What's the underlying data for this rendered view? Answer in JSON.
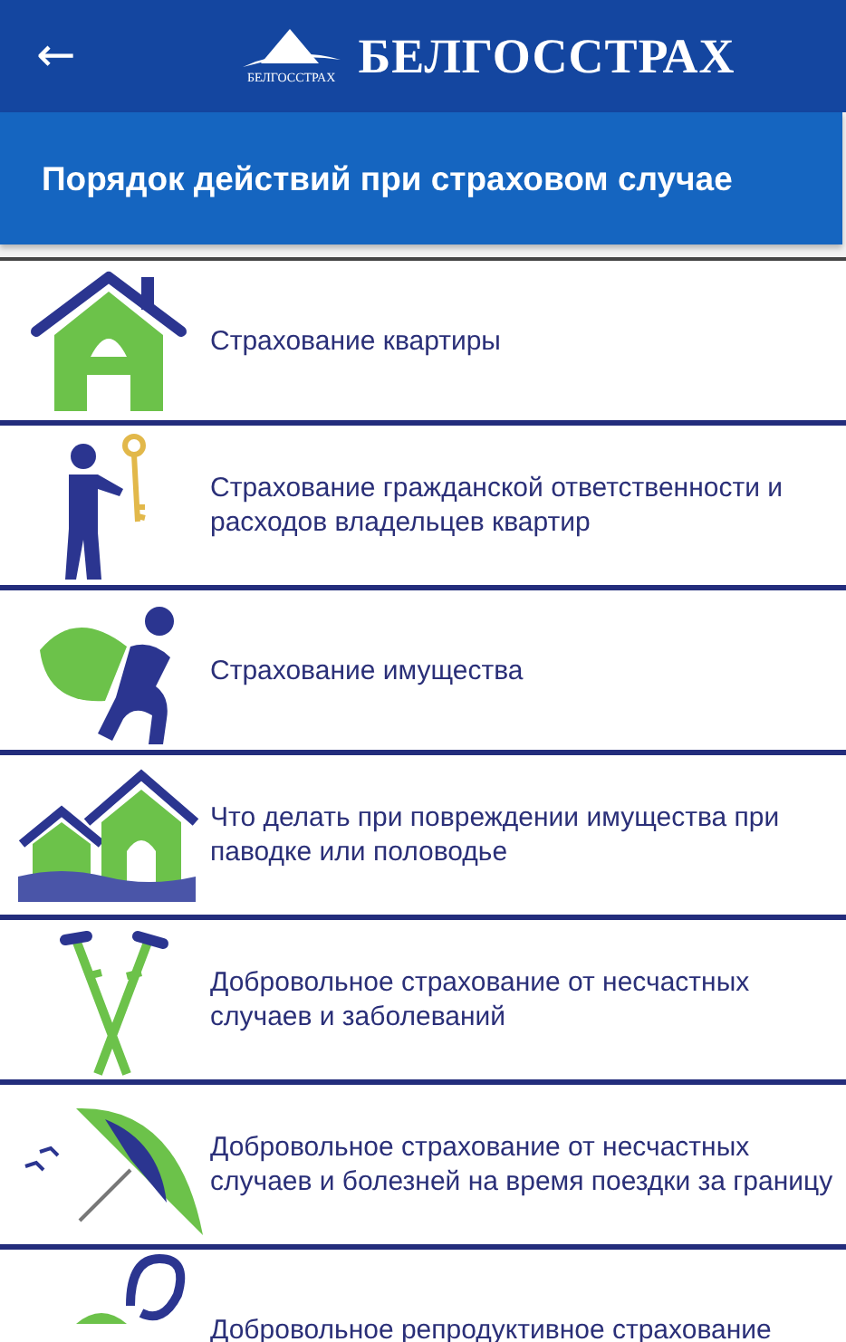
{
  "app_bar": {
    "back": "←",
    "brand": "БЕЛГОССТРАХ",
    "logo_caption": "БЕЛГОССТРАХ"
  },
  "title": "Порядок действий при страховом случае",
  "items": [
    {
      "kind": "house",
      "label": "Страхование квартиры"
    },
    {
      "kind": "key",
      "label": "Страхование гражданской ответственности и расходов владельцев квартир"
    },
    {
      "kind": "bag",
      "label": "Страхование имущества"
    },
    {
      "kind": "flood",
      "label": "Что делать при повреждении имущества при паводке или половодье"
    },
    {
      "kind": "crutches",
      "label": "Добровольное страхование от несчастных случаев и заболеваний"
    },
    {
      "kind": "umbrella",
      "label": "Добровольное страхование от несчастных случаев и болезней на время поездки за границу"
    },
    {
      "kind": "stork",
      "label": "Добровольное репродуктивное страхование"
    }
  ]
}
